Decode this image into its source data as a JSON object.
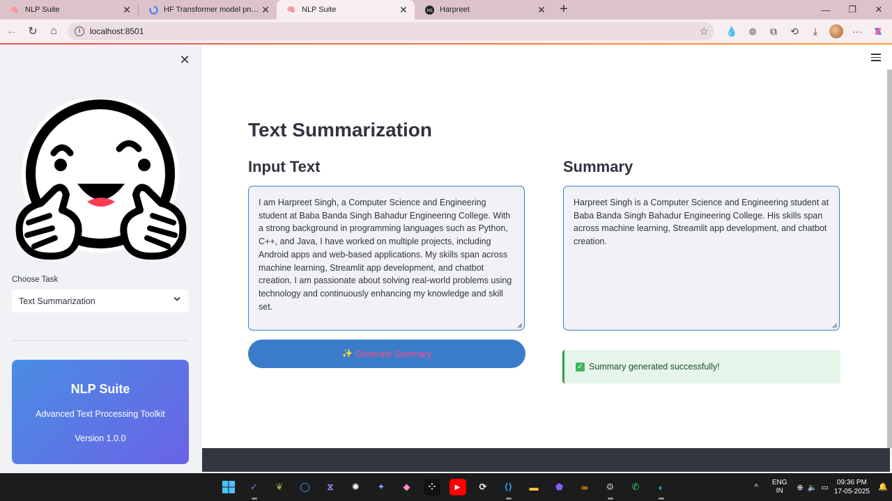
{
  "browser": {
    "tabs": [
      {
        "title": "NLP Suite",
        "active": false
      },
      {
        "title": "HF Transformer model png - Goo",
        "active": false
      },
      {
        "title": "NLP Suite",
        "active": true
      },
      {
        "title": "Harpreet",
        "active": false
      }
    ],
    "new_tab": "+",
    "url": "localhost:8501"
  },
  "sidebar": {
    "close": "✕",
    "select_label": "Choose Task",
    "selected_task": "Text Summarization",
    "card": {
      "title": "NLP Suite",
      "subtitle": "Advanced Text Processing Toolkit",
      "version": "Version 1.0.0",
      "gradient": [
        "#4a8de3",
        "#6a63e6"
      ]
    }
  },
  "main": {
    "title": "Text Summarization",
    "input_heading": "Input Text",
    "input_text": "I am Harpreet Singh, a Computer Science and Engineering student at Baba Banda Singh Bahadur Engineering College. With a strong background in programming languages such as Python, C++, and Java, I have worked on multiple projects, including Android apps and web-based applications. My skills span across machine learning, Streamlit app development, and chatbot creation. I am passionate about solving real-world problems using technology and continuously enhancing my knowledge and skill set.",
    "summary_heading": "Summary",
    "summary_text": "Harpreet Singh is a Computer Science and Engineering student at Baba Banda Singh Bahadur Engineering College. His skills span across machine learning, Streamlit app development, and chatbot creation.",
    "button_icon": "✨",
    "button_label": "Generate Summary",
    "success_message": "Summary generated successfully!",
    "accent": "#3a7cc9",
    "success_color": "#2e9e4a"
  },
  "taskbar": {
    "icons": [
      "windows-start-icon",
      "copilot-app-icon",
      "leaf-app-icon",
      "circle-app-icon",
      "vs-app-icon",
      "chatgpt-icon",
      "gemini-icon",
      "copilot-icon",
      "dots-app-icon",
      "youtube-icon",
      "cycle-app-icon",
      "vscode-icon",
      "file-explorer-icon",
      "obsidian-icon",
      "colab-icon",
      "settings-icon",
      "whatsapp-icon",
      "edge-icon"
    ],
    "lang_top": "ENG",
    "lang_bottom": "IN",
    "time": "09:36 PM",
    "date": "17-05-2025"
  }
}
